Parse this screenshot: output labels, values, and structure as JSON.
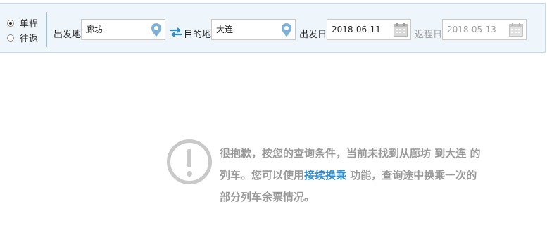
{
  "trip_type": {
    "options": [
      {
        "label": "单程",
        "checked": true
      },
      {
        "label": "往返",
        "checked": false
      }
    ]
  },
  "search": {
    "from_label": "出发地",
    "from_value": "廊坊",
    "to_label": "目的地",
    "to_value": "大连",
    "depart_label": "出发日",
    "depart_value": "2018-06-11",
    "return_label": "返程日",
    "return_value": "2018-05-13"
  },
  "icons": {
    "location": "map-pin-icon",
    "swap": "swap-arrows-icon",
    "calendar": "calendar-icon",
    "notice": "exclamation-circle-icon"
  },
  "colors": {
    "bar_background": "#eef5fb",
    "pin": "#7fb1d8",
    "swap": "#2a8fc7",
    "notice_text": "#999999",
    "link": "#2f8bd0"
  },
  "notice": {
    "line1": "很抱歉，按您的查询条件，当前未找到从廊坊 到大连 的",
    "line2_prefix": "列车。您可以使用",
    "line2_link": "接续换乘",
    "line2_suffix": " 功能，查询途中换乘一次的",
    "line3": "部分列车余票情况。"
  }
}
